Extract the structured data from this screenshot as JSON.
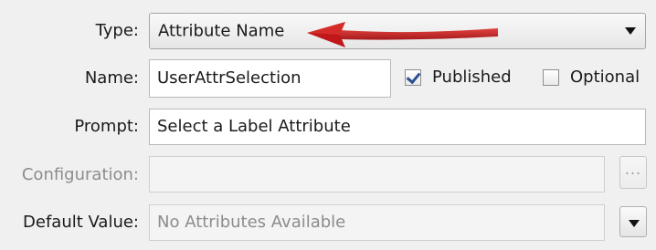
{
  "type": {
    "label": "Type:",
    "value": "Attribute Name"
  },
  "name": {
    "label": "Name:",
    "value": "UserAttrSelection"
  },
  "published": {
    "label": "Published",
    "checked": true
  },
  "optional": {
    "label": "Optional",
    "checked": false
  },
  "prompt": {
    "label": "Prompt:",
    "value": "Select a Label Attribute"
  },
  "configuration": {
    "label": "Configuration:",
    "value": "",
    "button_label": "..."
  },
  "default_value": {
    "label": "Default Value:",
    "placeholder": "No Attributes Available"
  },
  "colors": {
    "arrow": "#c0171b",
    "field_border": "#b9b9b9",
    "disabled_text": "#8c8c8c"
  },
  "icons": {
    "dropdown": "chevron-down-icon",
    "browse": "ellipsis-icon",
    "annotation": "red-arrow-icon"
  }
}
